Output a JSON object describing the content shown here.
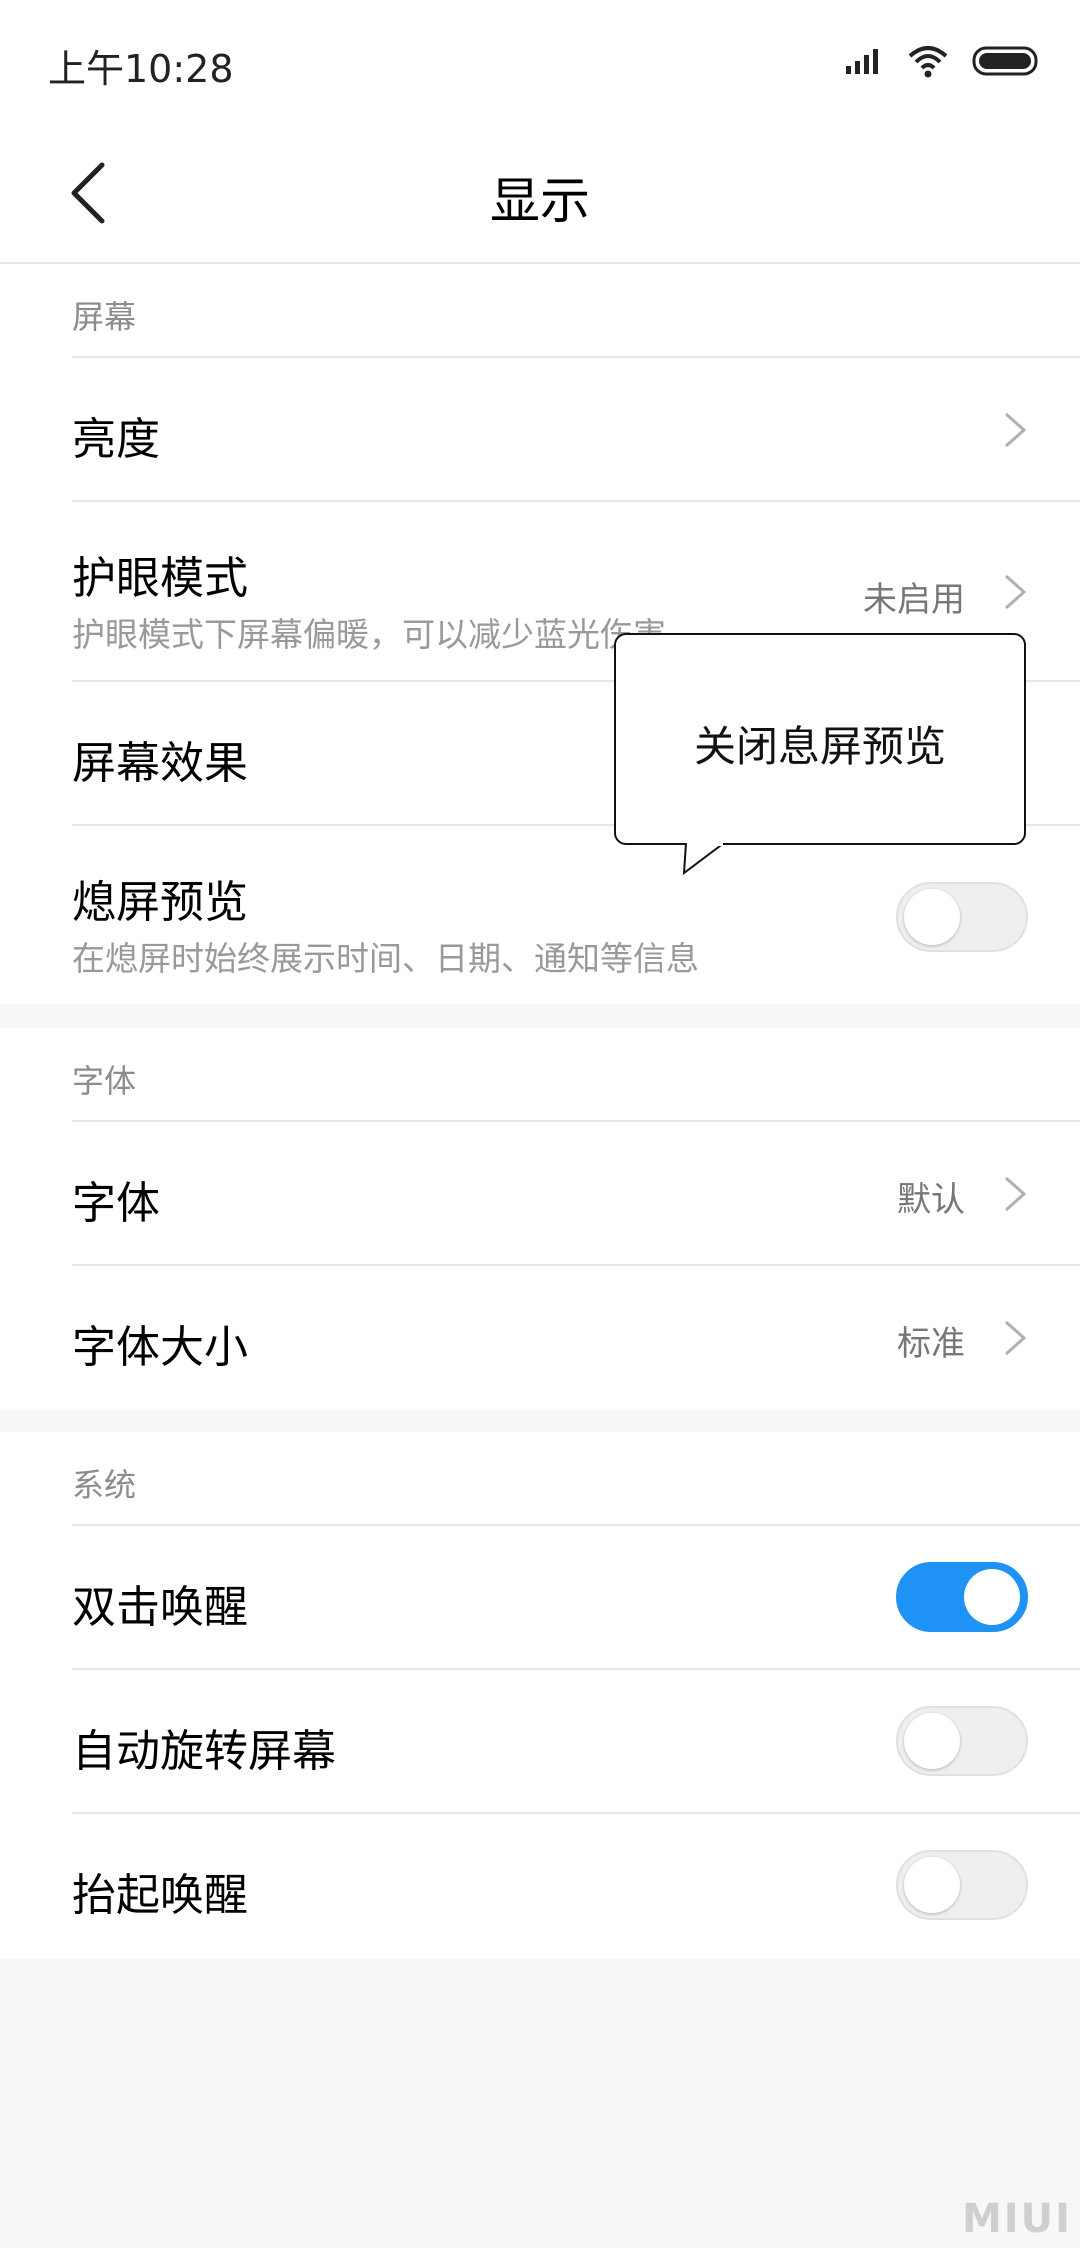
{
  "status_bar": {
    "time": "上午10:28",
    "icons": [
      "signal-icon",
      "wifi-icon",
      "battery-icon"
    ]
  },
  "header": {
    "title": "显示",
    "back_icon": "back-arrow-icon"
  },
  "sections": {
    "screen": {
      "label": "屏幕",
      "brightness": {
        "title": "亮度"
      },
      "eye_care": {
        "title": "护眼模式",
        "subtitle": "护眼模式下屏幕偏暖，可以减少蓝光伤害",
        "value": "未启用"
      },
      "screen_effect": {
        "title": "屏幕效果"
      },
      "aod_preview": {
        "title": "熄屏预览",
        "subtitle": "在熄屏时始终展示时间、日期、通知等信息",
        "enabled": false
      }
    },
    "font": {
      "label": "字体",
      "font": {
        "title": "字体",
        "value": "默认"
      },
      "font_size": {
        "title": "字体大小",
        "value": "标准"
      }
    },
    "system": {
      "label": "系统",
      "double_tap_wake": {
        "title": "双击唤醒",
        "enabled": true
      },
      "auto_rotate": {
        "title": "自动旋转屏幕",
        "enabled": false
      },
      "lift_to_wake": {
        "title": "抬起唤醒",
        "enabled": false
      }
    }
  },
  "callout": {
    "text": "关闭息屏预览"
  },
  "watermark": {
    "text": "MIUI"
  },
  "colors": {
    "accent": "#1e93f5",
    "page_bg": "#f7f7f7",
    "divider": "#e6e6e6",
    "secondary_text": "#999999"
  }
}
